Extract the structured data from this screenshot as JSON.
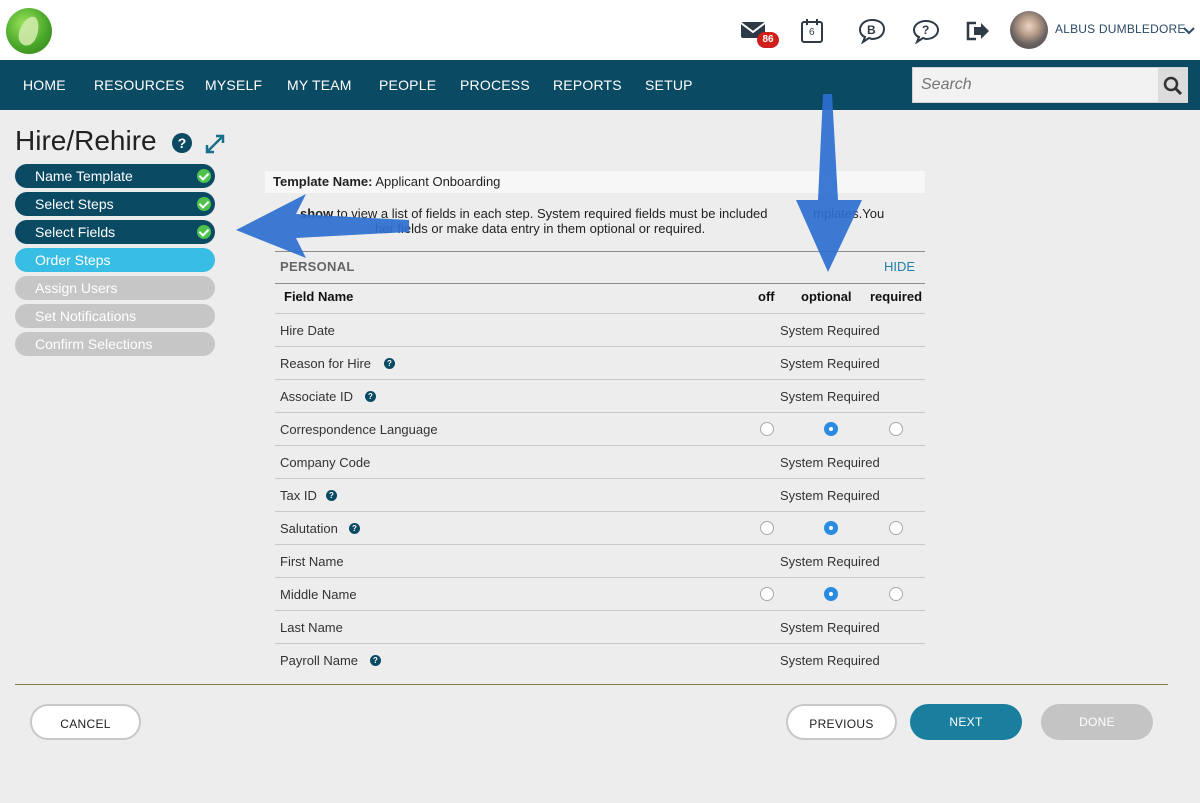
{
  "header": {
    "mail_badge": "86",
    "calendar_day": "6",
    "user_name": "ALBUS DUMBLEDORE",
    "icons": [
      "mail-icon",
      "calendar-icon",
      "b-chat-icon",
      "help-chat-icon",
      "logout-icon",
      "chevron-down-icon"
    ]
  },
  "nav": {
    "items": [
      "HOME",
      "RESOURCES",
      "MYSELF",
      "MY TEAM",
      "PEOPLE",
      "PROCESS",
      "REPORTS",
      "SETUP"
    ],
    "search_placeholder": "Search"
  },
  "page": {
    "title": "Hire/Rehire",
    "help": "?"
  },
  "steps": [
    {
      "label": "Name Template",
      "state": "done"
    },
    {
      "label": "Select Steps",
      "state": "done"
    },
    {
      "label": "Select Fields",
      "state": "done"
    },
    {
      "label": "Order Steps",
      "state": "active"
    },
    {
      "label": "Assign Users",
      "state": "pending"
    },
    {
      "label": "Set Notifications",
      "state": "pending"
    },
    {
      "label": "Confirm Selections",
      "state": "pending"
    }
  ],
  "template": {
    "name_label": "Template Name:",
    "name_value": "Applicant Onboarding",
    "instructions_bold": "show",
    "instructions_line1": " to view a list of fields in each step. System required fields must be included ",
    "instructions_line1_end": "mplates.You",
    "instructions_line2": "her fields or make data entry in them optional or required."
  },
  "section": {
    "title": "PERSONAL",
    "hide_link": "HIDE",
    "columns": {
      "field": "Field Name",
      "off": "off",
      "optional": "optional",
      "required": "required"
    },
    "rows": [
      {
        "label": "Hire Date",
        "help": false,
        "status": "System Required"
      },
      {
        "label": "Reason for Hire",
        "help": true,
        "status": "System Required"
      },
      {
        "label": "Associate ID",
        "help": true,
        "status": "System Required"
      },
      {
        "label": "Correspondence Language",
        "help": false,
        "status": "",
        "selected": "optional"
      },
      {
        "label": "Company Code",
        "help": false,
        "status": "System Required"
      },
      {
        "label": "Tax ID",
        "help": true,
        "status": "System Required"
      },
      {
        "label": "Salutation",
        "help": true,
        "status": "",
        "selected": "optional"
      },
      {
        "label": "First Name",
        "help": false,
        "status": "System Required"
      },
      {
        "label": "Middle Name",
        "help": false,
        "status": "",
        "selected": "optional"
      },
      {
        "label": "Last Name",
        "help": false,
        "status": "System Required"
      },
      {
        "label": "Payroll Name",
        "help": true,
        "status": "System Required"
      }
    ]
  },
  "footer": {
    "cancel": "CANCEL",
    "previous": "PREVIOUS",
    "next": "NEXT",
    "done": "DONE"
  },
  "colors": {
    "nav": "#0b4a63",
    "step_done": "#0b4a63",
    "step_active": "#38bde4",
    "step_pending": "#c6c6c6",
    "primary_button": "#1a7f9e",
    "annotation_arrow": "#2d6fcf",
    "radio_selected": "#2b8be0"
  }
}
